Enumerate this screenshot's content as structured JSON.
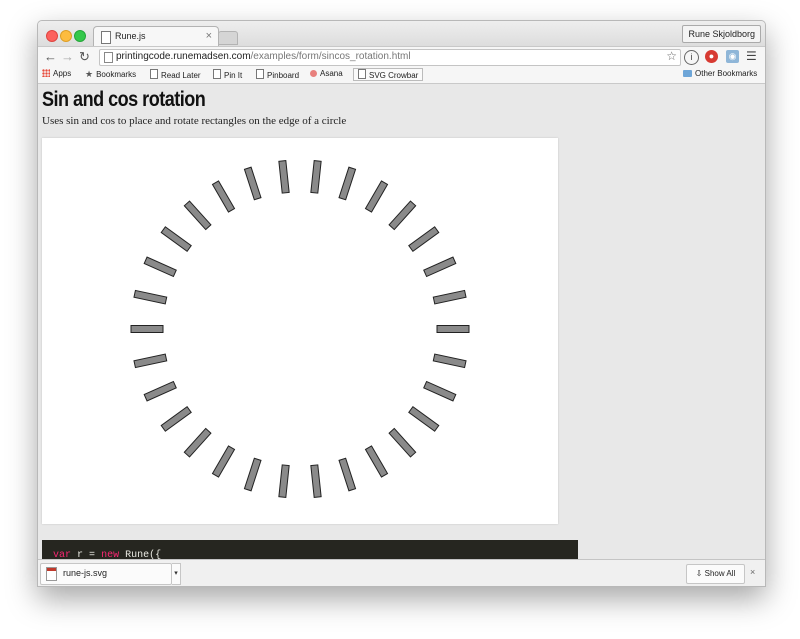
{
  "browser": {
    "tab_title": "Rune.js",
    "tab_close": "×",
    "profile_name": "Rune Skjoldborg",
    "url_host": "printingcode.runemadsen.com",
    "url_path": "/examples/form/sincos_rotation.html",
    "bookmarks": {
      "apps": "Apps",
      "bookmarks": "Bookmarks",
      "read_later": "Read Later",
      "pin_it": "Pin It",
      "pinboard": "Pinboard",
      "asana": "Asana",
      "svg_crowbar": "SVG Crowbar",
      "other": "Other Bookmarks"
    }
  },
  "page": {
    "title": "Sin and cos rotation",
    "description": "Uses sin and cos to place and rotate rectangles on the edge of a circle",
    "code_line": "var r = new Rune({",
    "code_keyword_var": "var",
    "code_keyword_new": "new",
    "code_var_name": "r",
    "code_class": "Rune({"
  },
  "graphic": {
    "rect_count": 30,
    "rect_fill": "#8a8a8a",
    "rect_stroke": "#222222"
  },
  "downloads": {
    "file_name": "rune-js.svg",
    "show_all": "Show All",
    "close": "×"
  }
}
